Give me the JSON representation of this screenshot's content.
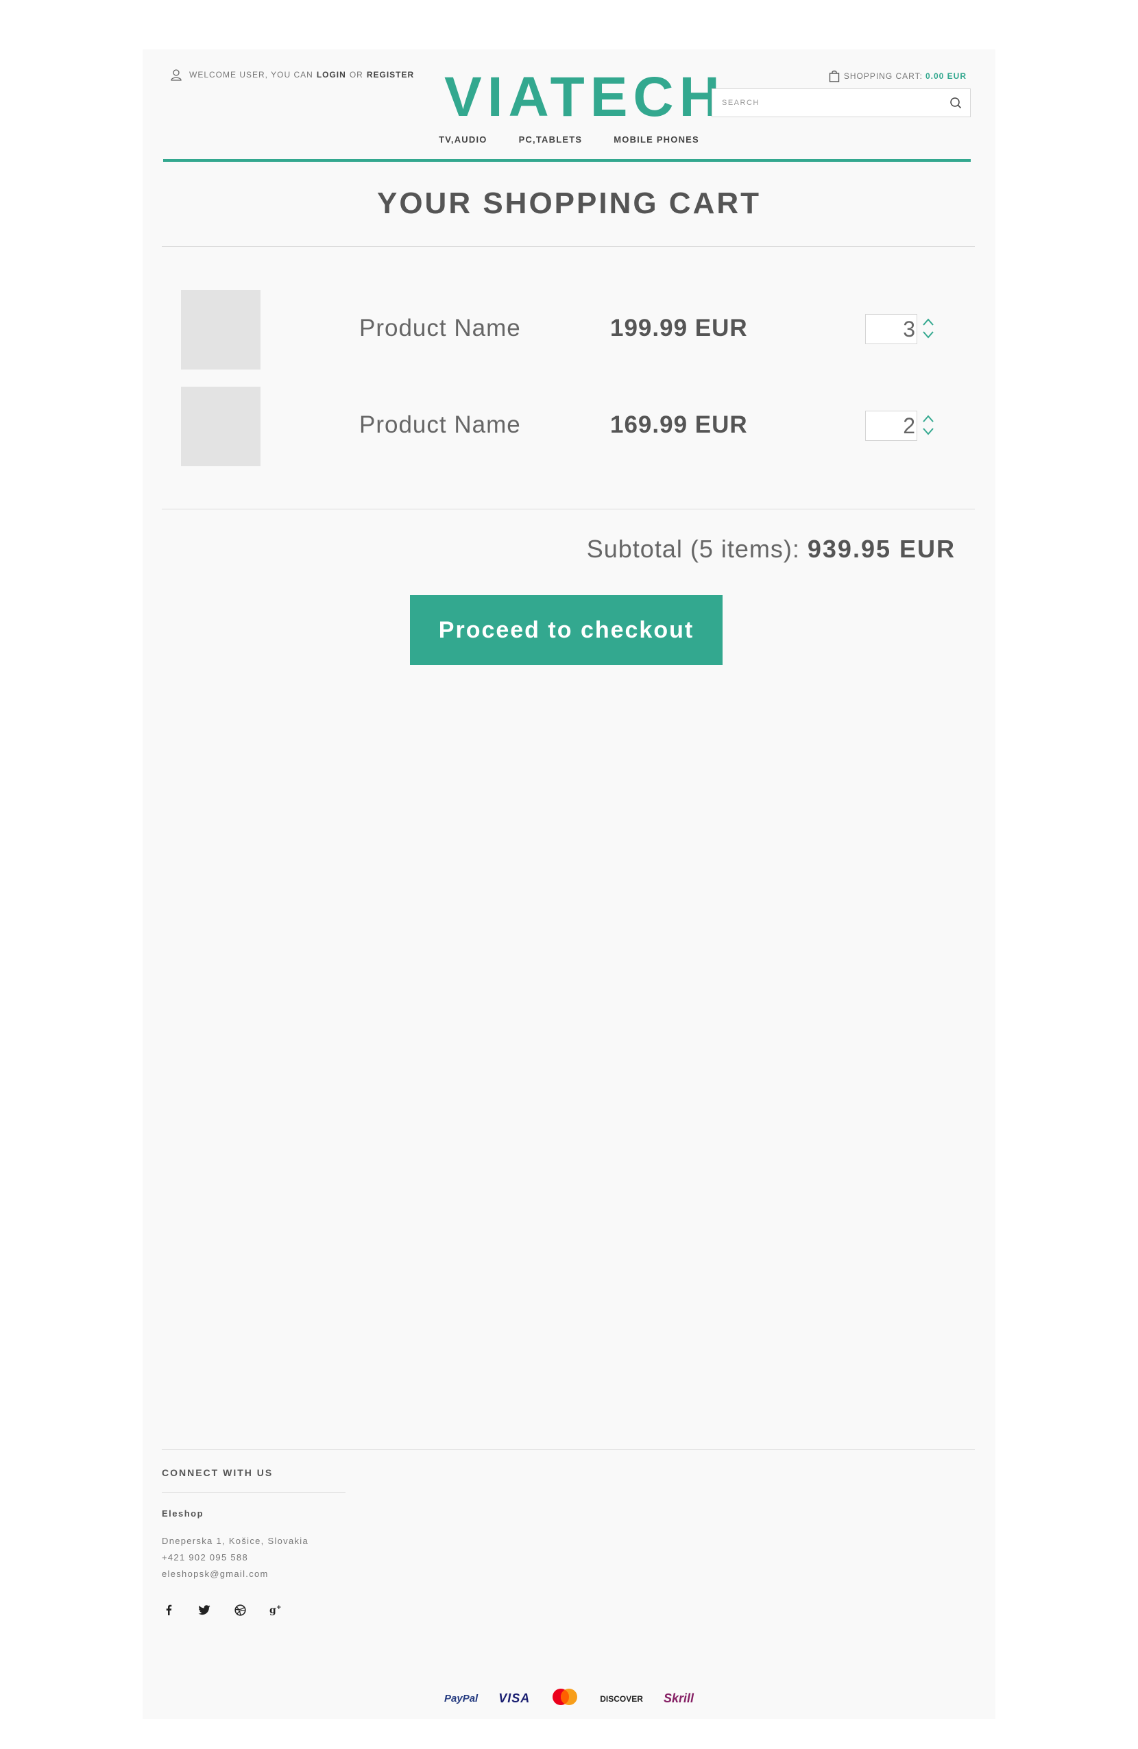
{
  "header": {
    "welcome_text": "WELCOME USER, YOU CAN",
    "login_label": "LOGIN",
    "or_text": "OR",
    "register_label": "REGISTER",
    "logo": "VIATECH",
    "cart_label": "SHOPPING CART:",
    "cart_amount": "0.00 EUR",
    "search_placeholder": "SEARCH"
  },
  "nav": {
    "items": [
      {
        "label": "TV,AUDIO"
      },
      {
        "label": "PC,TABLETS"
      },
      {
        "label": "MOBILE PHONES"
      }
    ]
  },
  "main": {
    "title": "YOUR SHOPPING CART",
    "items": [
      {
        "name": "Product Name",
        "price": "199.99 EUR",
        "quantity": "3"
      },
      {
        "name": "Product Name",
        "price": "169.99 EUR",
        "quantity": "2"
      }
    ],
    "subtotal_label": "Subtotal (5 items):",
    "subtotal_value": "939.95 EUR",
    "checkout_label": "Proceed to checkout"
  },
  "footer": {
    "connect_title": "CONNECT WITH US",
    "company": "Eleshop",
    "address": "Dneperska 1, Košice, Slovakia",
    "phone": "+421 902 095 588",
    "email": "eleshopsk@gmail.com",
    "social": [
      "facebook-icon",
      "twitter-icon",
      "dribbble-icon",
      "google-plus-icon"
    ],
    "payments": {
      "paypal": "PayPal",
      "visa": "VISA",
      "mastercard": "MasterCard",
      "discover": "DISCOVER",
      "skrill": "Skrill"
    }
  },
  "colors": {
    "accent": "#33a88f",
    "page_bg": "#f9f9f9",
    "text_dark": "#555555",
    "thumb_placeholder": "#e3e3e3"
  }
}
